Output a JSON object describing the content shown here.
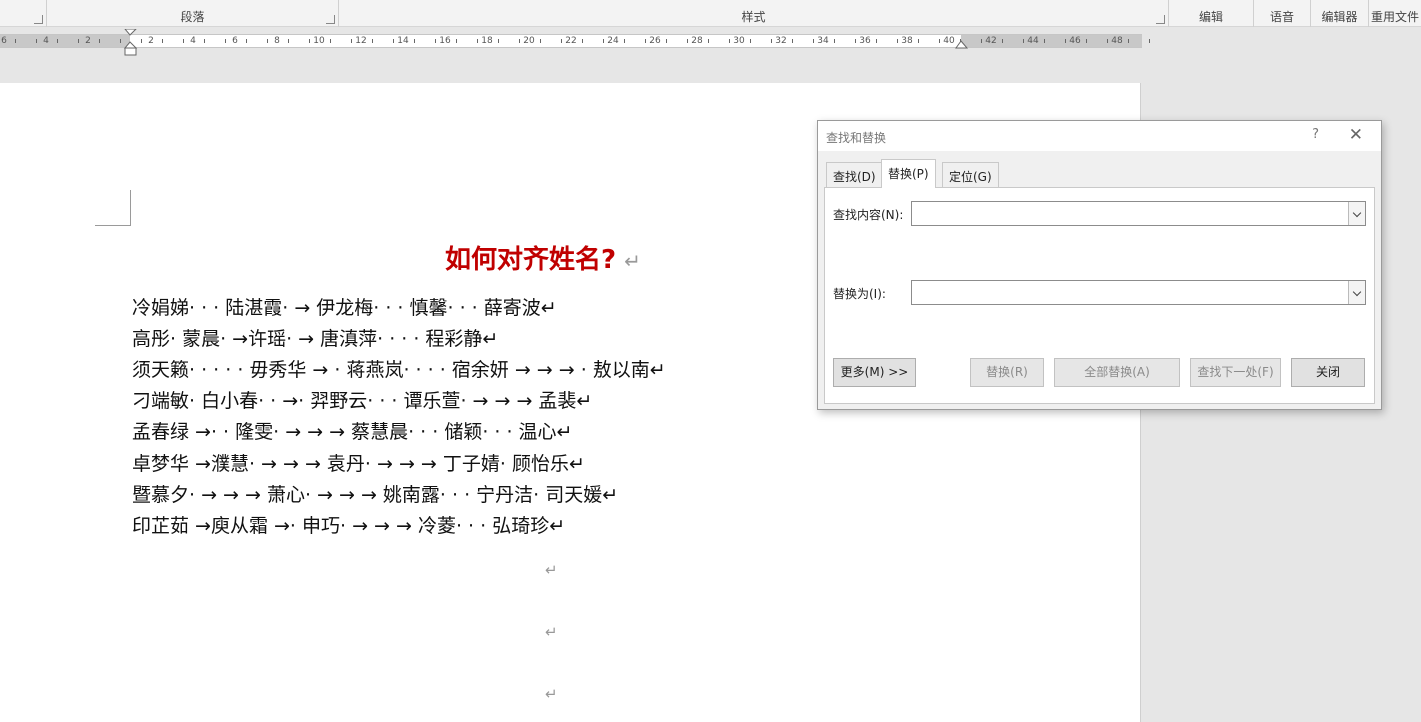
{
  "ribbon": {
    "paragraph": "段落",
    "styles": "样式",
    "editing": "编辑",
    "voice": "语音",
    "editor": "编辑器",
    "reuse_files": "重用文件"
  },
  "ruler": {
    "left_ticks": [
      "6",
      "4",
      "2"
    ],
    "right_ticks": [
      "2",
      "4",
      "6",
      "8",
      "10",
      "12",
      "14",
      "16",
      "18",
      "20",
      "22",
      "24",
      "26",
      "28",
      "30",
      "32",
      "34",
      "36",
      "38",
      "40",
      "42",
      "44",
      "46",
      "48"
    ]
  },
  "document": {
    "title": "如何对齐姓名?",
    "paragraph_mark": "↵",
    "lines": [
      "冷娟娣· · · 陆湛霞·  →  伊龙梅· · · 慎馨· · · 薛寄波↵",
      "高彤· 蒙晨· →许瑶·  →  唐滇萍· · · · 程彩静↵",
      "须天籁· · · · · 毋秀华 → · 蒋燕岚· · · · 宿余妍 →   →   → · 敖以南↵",
      "刁端敏· 白小春· · →· 羿野云· · · 谭乐萱·  →   →   →  孟裴↵",
      "孟春绿 →· · 隆雯· →  →   →  蔡慧晨· · · 储颖· · · 温心↵",
      "卓梦华 →濮慧·  →   →   →  袁丹·  →   →   →  丁子婧· 顾怡乐↵",
      "暨慕夕· →  →   →  萧心·  →   →   →  姚南露· · · 宁丹洁· 司天媛↵",
      "印芷茹 →庾从霜 →· 申巧· →   →   →  冷菱· · · 弘琦珍↵"
    ]
  },
  "dialog": {
    "title": "查找和替换",
    "help": "?",
    "close": "✕",
    "tabs": [
      "查找(D)",
      "替换(P)",
      "定位(G)"
    ],
    "active_tab": "替换(P)",
    "find_label": "查找内容(N):",
    "find_value": "",
    "replace_label": "替换为(I):",
    "replace_value": "",
    "buttons": {
      "more": "更多(M) >>",
      "replace": "替换(R)",
      "replace_all": "全部替换(A)",
      "find_next": "查找下一处(F)",
      "close": "关闭"
    }
  }
}
